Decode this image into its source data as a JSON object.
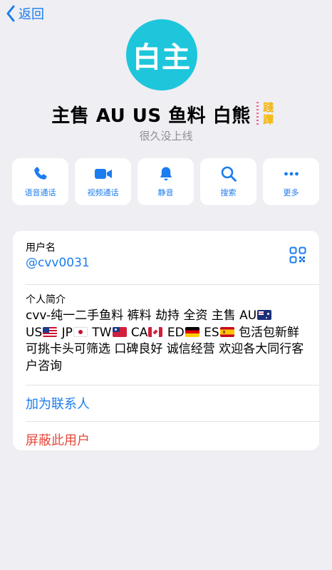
{
  "nav": {
    "back_label": "返回"
  },
  "profile": {
    "avatar_text": "白主",
    "name": "主售 AU US 鱼料 白熊",
    "stamp_line1": "踐",
    "stamp_line2": "蹕",
    "status": "很久没上线"
  },
  "actions": [
    {
      "label": "语音通话",
      "icon": "phone-icon"
    },
    {
      "label": "视频通话",
      "icon": "video-icon"
    },
    {
      "label": "静音",
      "icon": "bell-icon"
    },
    {
      "label": "搜索",
      "icon": "search-icon"
    },
    {
      "label": "更多",
      "icon": "more-icon"
    }
  ],
  "info": {
    "username_label": "用户名",
    "username": "@cvv0031",
    "bio_label": "个人简介",
    "bio_parts": [
      "cvv-纯一二手鱼料 裤料 劫持 全资 主售 AU",
      "US",
      " JP",
      " TW",
      " CA",
      " ED",
      " ES",
      " 包活包新鲜 可挑卡头可筛选 口碑良好 诚信经营 欢迎各大同行客户咨询"
    ],
    "add_contact": "加为联系人",
    "block_user": "屏蔽此用户"
  },
  "colors": {
    "accent": "#1a7cf0",
    "danger": "#e5493a",
    "avatar": "#1ec6dc",
    "background": "#eeeef3"
  }
}
